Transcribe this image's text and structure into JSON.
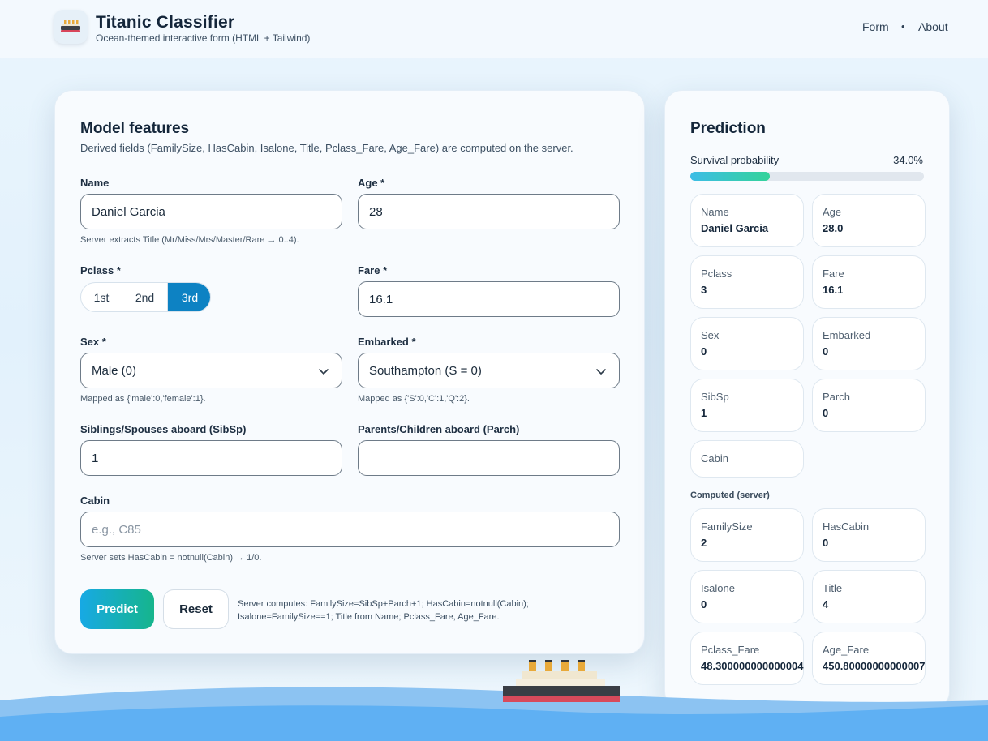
{
  "header": {
    "title": "Titanic Classifier",
    "subtitle": "Ocean-themed interactive form (HTML + Tailwind)",
    "nav": {
      "form": "Form",
      "separator": "•",
      "about": "About"
    }
  },
  "form": {
    "title": "Model features",
    "description": "Derived fields (FamilySize, HasCabin, Isalone, Title, Pclass_Fare, Age_Fare) are computed on the server.",
    "name": {
      "label": "Name",
      "value": "Daniel Garcia",
      "hint": "Server extracts Title (Mr/Miss/Mrs/Master/Rare → 0..4)."
    },
    "age": {
      "label": "Age *",
      "value": "28"
    },
    "pclass": {
      "label": "Pclass *",
      "options": [
        "1st",
        "2nd",
        "3rd"
      ],
      "selected": "3rd"
    },
    "fare": {
      "label": "Fare *",
      "value": "16.1"
    },
    "sex": {
      "label": "Sex *",
      "value": "Male (0)",
      "hint": "Mapped as {'male':0,'female':1}."
    },
    "embarked": {
      "label": "Embarked *",
      "value": "Southampton (S = 0)",
      "hint": "Mapped as {'S':0,'C':1,'Q':2}."
    },
    "sibsp": {
      "label": "Siblings/Spouses aboard (SibSp)",
      "value": "1"
    },
    "parch": {
      "label": "Parents/Children aboard (Parch)",
      "value": ""
    },
    "cabin": {
      "label": "Cabin",
      "value": "",
      "placeholder": "e.g., C85",
      "hint": "Server sets HasCabin = notnull(Cabin) → 1/0."
    },
    "buttons": {
      "predict": "Predict",
      "reset": "Reset"
    },
    "server_note": "Server computes: FamilySize=SibSp+Parch+1; HasCabin=notnull(Cabin); Isalone=FamilySize==1; Title from Name; Pclass_Fare, Age_Fare."
  },
  "prediction": {
    "title": "Prediction",
    "probability_label": "Survival probability",
    "probability_text": "34.0%",
    "probability": 0.34,
    "inputs": [
      {
        "key": "Name",
        "value": "Daniel Garcia"
      },
      {
        "key": "Age",
        "value": "28.0"
      },
      {
        "key": "Pclass",
        "value": "3"
      },
      {
        "key": "Fare",
        "value": "16.1"
      },
      {
        "key": "Sex",
        "value": "0"
      },
      {
        "key": "Embarked",
        "value": "0"
      },
      {
        "key": "SibSp",
        "value": "1"
      },
      {
        "key": "Parch",
        "value": "0"
      },
      {
        "key": "Cabin",
        "value": ""
      }
    ],
    "computed_heading": "Computed (server)",
    "computed": [
      {
        "key": "FamilySize",
        "value": "2"
      },
      {
        "key": "HasCabin",
        "value": "0"
      },
      {
        "key": "Isalone",
        "value": "0"
      },
      {
        "key": "Title",
        "value": "4"
      },
      {
        "key": "Pclass_Fare",
        "value": "48.300000000000004"
      },
      {
        "key": "Age_Fare",
        "value": "450.80000000000007"
      }
    ]
  },
  "colors": {
    "accent": "#0d82c3",
    "predict_gradient_start": "#17a9e4",
    "predict_gradient_end": "#16b58c"
  }
}
